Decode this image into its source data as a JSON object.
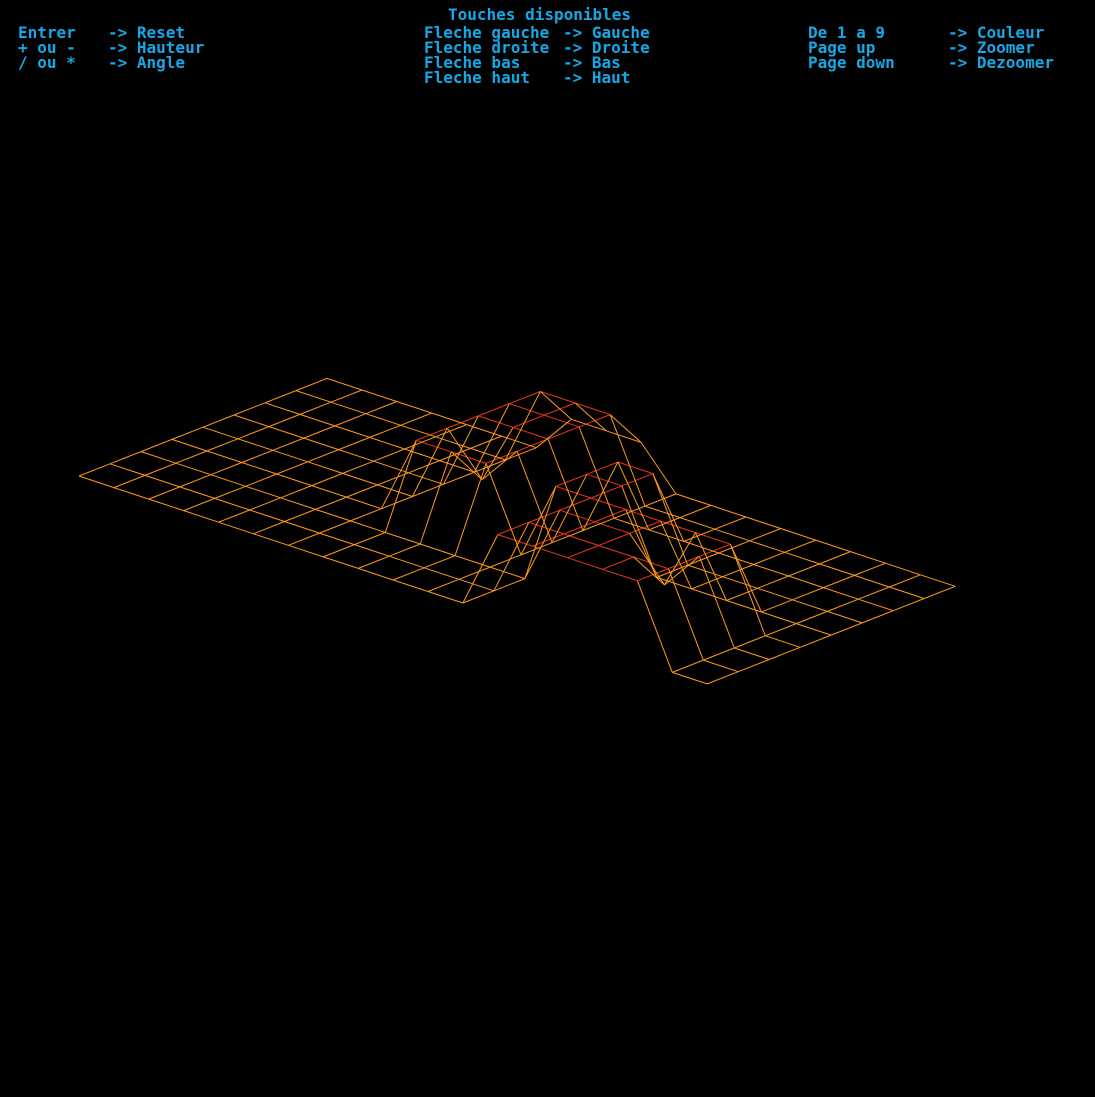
{
  "hud": {
    "title": "Touches disponibles",
    "columns": [
      [
        {
          "key": "Entrer",
          "action": "-> Reset"
        },
        {
          "key": "+ ou -",
          "action": "-> Hauteur"
        },
        {
          "key": "/ ou *",
          "action": "-> Angle"
        }
      ],
      [
        {
          "key": "Fleche gauche",
          "action": "-> Gauche"
        },
        {
          "key": "Fleche droite",
          "action": "-> Droite"
        },
        {
          "key": "Fleche bas",
          "action": "-> Bas"
        },
        {
          "key": "Fleche haut",
          "action": "-> Haut"
        }
      ],
      [
        {
          "key": "De 1 a 9",
          "action": "-> Couleur"
        },
        {
          "key": "Page up",
          "action": "-> Zoomer"
        },
        {
          "key": "Page down",
          "action": "-> Dezoomer"
        }
      ]
    ],
    "text_color": "#16a8e6"
  },
  "scene": {
    "background": "#000000",
    "low_color": "#ff9a1a",
    "high_color": "#e8361a"
  }
}
